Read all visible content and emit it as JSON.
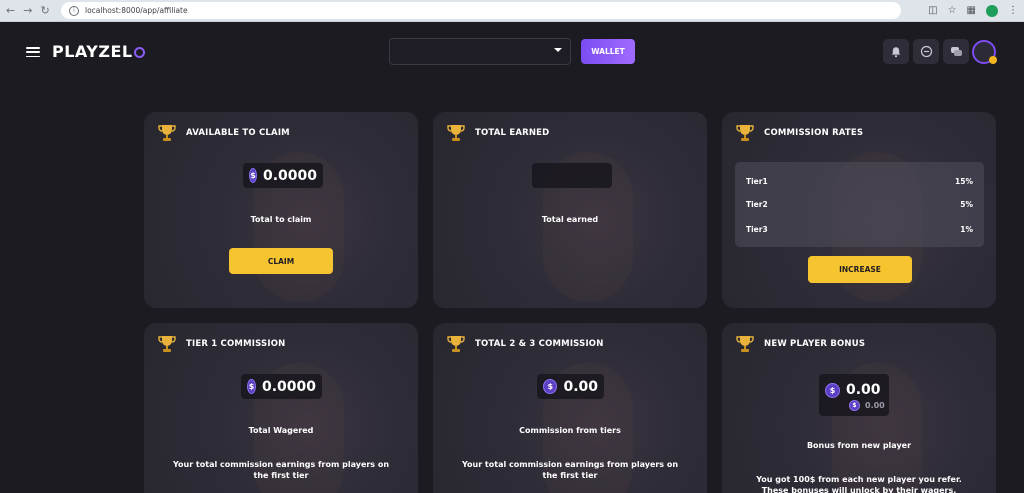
{
  "browser": {
    "url": "localhost:8000/app/affiliate"
  },
  "header": {
    "logo_text": "PLAYZEL",
    "wallet_label": "WALLET",
    "accent": "#7b4df2",
    "icons": [
      "bell-icon",
      "chat-bubble-icon",
      "messages-icon"
    ]
  },
  "cards": {
    "available": {
      "title": "AVAILABLE TO CLAIM",
      "amount": "0.0000",
      "caption": "Total to claim",
      "button": "CLAIM"
    },
    "earned": {
      "title": "TOTAL EARNED",
      "caption": "Total earned"
    },
    "rates": {
      "title": "COMMISSION RATES",
      "rows": [
        {
          "label": "Tier1",
          "value": "15%"
        },
        {
          "label": "Tier2",
          "value": "5%"
        },
        {
          "label": "Tier3",
          "value": "1%"
        }
      ],
      "button": "INCREASE"
    },
    "tier1": {
      "title": "TIER 1 COMMISSION",
      "amount": "0.0000",
      "caption": "Total Wagered",
      "desc": "Your total commission earnings from players on the first tier"
    },
    "tier23": {
      "title": "TOTAL 2 & 3 COMMISSION",
      "amount": "0.00",
      "caption": "Commission from tiers",
      "desc": "Your total commission earnings from players on the first tier"
    },
    "bonus": {
      "title": "NEW PLAYER BONUS",
      "amount": "0.00",
      "sub_amount": "0.00",
      "caption": "Bonus from new player",
      "desc": "You got 100$ from each new player you refer. These bonuses will unlock by their wagers."
    }
  },
  "colors": {
    "button_yellow": "#f6c42f",
    "coin_purple": "#5b3fc4"
  }
}
